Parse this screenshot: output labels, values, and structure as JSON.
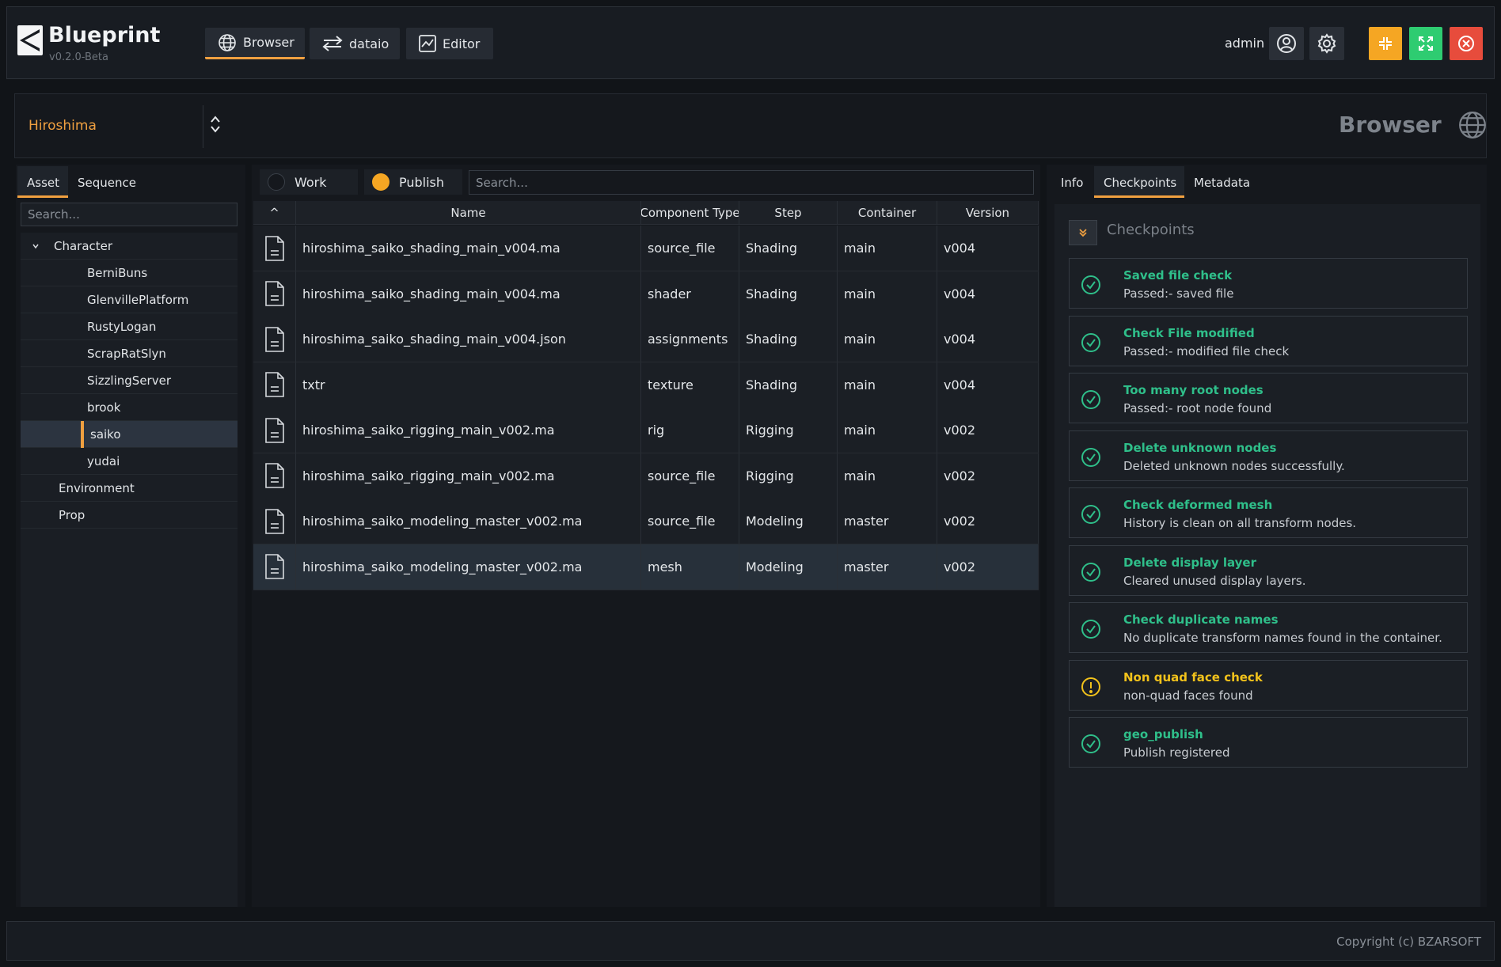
{
  "app": {
    "title": "Blueprint",
    "version": "v0.2.0-Beta",
    "user": "admin"
  },
  "nav": {
    "browser": "Browser",
    "dataio": "dataio",
    "editor": "Editor"
  },
  "project": {
    "name": "Hiroshima",
    "section_title": "Browser"
  },
  "left": {
    "tabs": [
      "Asset",
      "Sequence"
    ],
    "search_placeholder": "Search...",
    "tree": {
      "character": "Character",
      "children": [
        "BerniBuns",
        "GlenvillePlatform",
        "RustyLogan",
        "ScrapRatSlyn",
        "SizzlingServer",
        "brook",
        "saiko",
        "yudai"
      ],
      "environment": "Environment",
      "prop": "Prop"
    }
  },
  "middle": {
    "work_label": "Work",
    "publish_label": "Publish",
    "search_placeholder": "Search...",
    "sort_indicator": "^",
    "columns": [
      "Name",
      "Component Type",
      "Step",
      "Container",
      "Version"
    ],
    "rows": [
      {
        "name": "hiroshima_saiko_shading_main_v004.ma",
        "type": "source_file",
        "step": "Shading",
        "container": "main",
        "version": "v004"
      },
      {
        "name": "hiroshima_saiko_shading_main_v004.ma",
        "type": "shader",
        "step": "Shading",
        "container": "main",
        "version": "v004"
      },
      {
        "name": "hiroshima_saiko_shading_main_v004.json",
        "type": "assignments",
        "step": "Shading",
        "container": "main",
        "version": "v004"
      },
      {
        "name": "txtr",
        "type": "texture",
        "step": "Shading",
        "container": "main",
        "version": "v004"
      },
      {
        "name": "hiroshima_saiko_rigging_main_v002.ma",
        "type": "rig",
        "step": "Rigging",
        "container": "main",
        "version": "v002"
      },
      {
        "name": "hiroshima_saiko_rigging_main_v002.ma",
        "type": "source_file",
        "step": "Rigging",
        "container": "main",
        "version": "v002"
      },
      {
        "name": "hiroshima_saiko_modeling_master_v002.ma",
        "type": "source_file",
        "step": "Modeling",
        "container": "master",
        "version": "v002"
      },
      {
        "name": "hiroshima_saiko_modeling_master_v002.ma",
        "type": "mesh",
        "step": "Modeling",
        "container": "master",
        "version": "v002"
      }
    ]
  },
  "right": {
    "tabs": [
      "Info",
      "Checkpoints",
      "Metadata"
    ],
    "checkpoints_title": "Checkpoints",
    "checkpoints": [
      {
        "title": "Saved file check",
        "desc": "Passed:- saved file",
        "status": "pass"
      },
      {
        "title": "Check File modified",
        "desc": "Passed:- modified file check",
        "status": "pass"
      },
      {
        "title": "Too many root nodes",
        "desc": "Passed:- root node found",
        "status": "pass"
      },
      {
        "title": "Delete unknown nodes",
        "desc": "Deleted unknown nodes successfully.",
        "status": "pass"
      },
      {
        "title": "Check deformed mesh",
        "desc": "History is clean on all transform nodes.",
        "status": "pass"
      },
      {
        "title": "Delete display layer",
        "desc": "Cleared unused display layers.",
        "status": "pass"
      },
      {
        "title": "Check duplicate names",
        "desc": "No duplicate transform names found in the container.",
        "status": "pass"
      },
      {
        "title": "Non quad face check",
        "desc": "non-quad faces found",
        "status": "warn"
      },
      {
        "title": "geo_publish",
        "desc": "Publish registered",
        "status": "pass"
      }
    ]
  },
  "footer": {
    "copyright": "Copyright (c) BZARSOFT"
  },
  "colors": {
    "accent": "#f0a040",
    "pass": "#2fbf8a",
    "warn": "#f2c21b",
    "minimize": "#f5a623",
    "maximize": "#2ecc71",
    "close": "#e74c3c"
  }
}
